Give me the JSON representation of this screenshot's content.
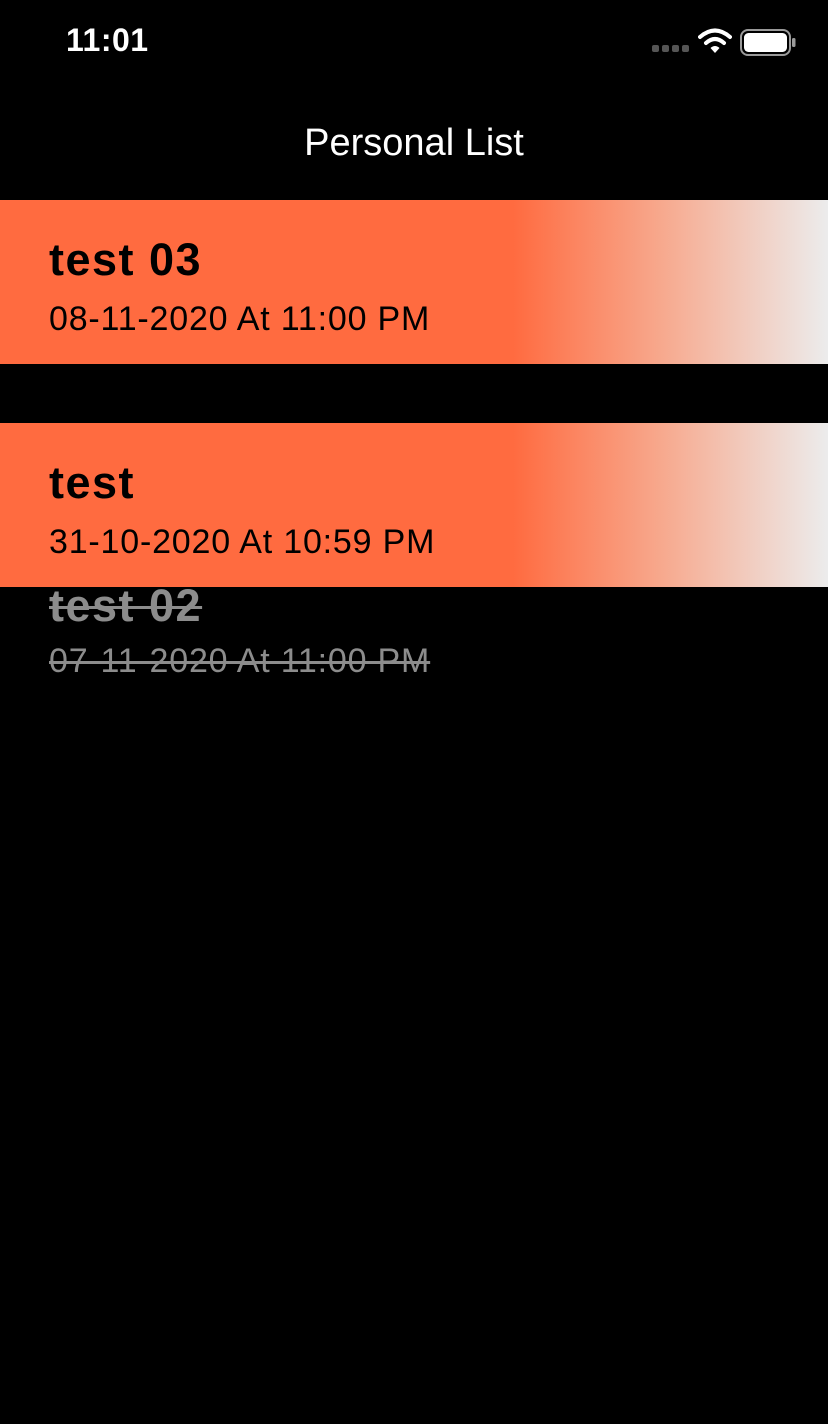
{
  "status_bar": {
    "time": "11:01",
    "icons": [
      "signal-icon",
      "wifi-icon",
      "battery-icon"
    ]
  },
  "nav": {
    "title": "Personal List"
  },
  "colors": {
    "background": "#000000",
    "row_accent": "#ff6b40",
    "row_fade": "#ececec",
    "completed_text": "#8c8c8c"
  },
  "tasks": [
    {
      "title": "test 03",
      "datetime": "08-11-2020 At 11:00 PM",
      "completed": false
    },
    {
      "title": "test",
      "datetime": "31-10-2020 At 10:59 PM",
      "completed": false
    },
    {
      "title": "test 02",
      "datetime": "07-11-2020 At 11:00 PM",
      "completed": true
    }
  ]
}
